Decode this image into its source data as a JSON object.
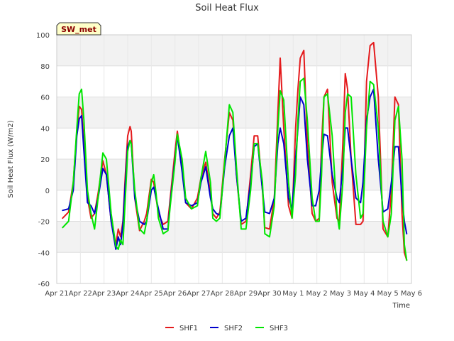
{
  "chart_data": {
    "type": "line",
    "title": "Soil Heat Flux",
    "xlabel": "Time",
    "ylabel": "Soil Heat Flux (W/m2)",
    "badge": "SW_met",
    "ylim": [
      -60,
      100
    ],
    "yticks": [
      -60,
      -40,
      -20,
      0,
      20,
      40,
      60,
      80,
      100
    ],
    "xlim": [
      0,
      15
    ],
    "xticks": [
      0,
      1,
      2,
      3,
      4,
      5,
      6,
      7,
      8,
      9,
      10,
      11,
      12,
      13,
      14,
      15
    ],
    "xtick_labels": [
      "Apr 21",
      "Apr 22",
      "Apr 23",
      "Apr 24",
      "Apr 25",
      "Apr 26",
      "Apr 27",
      "Apr 28",
      "Apr 29",
      "Apr 30",
      "May 1",
      "May 2",
      "May 3",
      "May 4",
      "May 5",
      "May 6"
    ],
    "grid": true,
    "legend_position": "bottom-center",
    "series": [
      {
        "name": "SHF1",
        "color": "#e41a1c",
        "x": [
          0.25,
          0.5,
          0.7,
          0.85,
          0.95,
          1.05,
          1.15,
          1.3,
          1.45,
          1.6,
          1.75,
          1.95,
          2.1,
          2.3,
          2.5,
          2.6,
          2.7,
          2.8,
          2.9,
          3.0,
          3.1,
          3.15,
          3.3,
          3.5,
          3.7,
          3.8,
          4.0,
          4.1,
          4.2,
          4.3,
          4.5,
          4.7,
          4.8,
          5.0,
          5.1,
          5.3,
          5.45,
          5.7,
          5.95,
          6.1,
          6.3,
          6.5,
          6.6,
          6.75,
          6.9,
          7.1,
          7.3,
          7.45,
          7.6,
          7.8,
          8.0,
          8.2,
          8.35,
          8.5,
          8.7,
          8.8,
          9.0,
          9.2,
          9.35,
          9.45,
          9.6,
          9.8,
          9.95,
          10.1,
          10.2,
          10.3,
          10.45,
          10.6,
          10.8,
          10.95,
          11.1,
          11.2,
          11.3,
          11.45,
          11.65,
          11.85,
          11.95,
          12.1,
          12.2,
          12.3,
          12.45,
          12.65,
          12.85,
          12.95,
          13.1,
          13.25,
          13.4,
          13.6,
          13.8,
          14.0,
          14.15,
          14.3,
          14.45,
          14.6,
          14.7,
          14.8
        ],
        "y": [
          -18,
          -14,
          5,
          38,
          54,
          52,
          30,
          -5,
          -18,
          -15,
          -2,
          19,
          10,
          -20,
          -35,
          -25,
          -30,
          -20,
          10,
          35,
          41,
          38,
          -5,
          -26,
          -20,
          -15,
          7,
          5,
          -5,
          -15,
          -22,
          -20,
          -5,
          25,
          38,
          15,
          -8,
          -12,
          -5,
          8,
          18,
          -2,
          -15,
          -18,
          -14,
          20,
          50,
          45,
          10,
          -22,
          -20,
          10,
          35,
          35,
          0,
          -24,
          -25,
          -5,
          50,
          85,
          40,
          -10,
          -18,
          40,
          65,
          85,
          90,
          30,
          -15,
          -20,
          -18,
          30,
          60,
          65,
          5,
          -18,
          -20,
          30,
          75,
          65,
          20,
          -22,
          -22,
          -20,
          70,
          93,
          95,
          60,
          -25,
          -30,
          0,
          60,
          55,
          -15,
          -40,
          -45
        ]
      },
      {
        "name": "SHF2",
        "color": "#0000cd",
        "x": [
          0.25,
          0.5,
          0.7,
          0.85,
          0.95,
          1.05,
          1.15,
          1.3,
          1.45,
          1.6,
          1.75,
          1.95,
          2.1,
          2.3,
          2.5,
          2.6,
          2.7,
          2.8,
          2.9,
          3.0,
          3.1,
          3.15,
          3.3,
          3.5,
          3.7,
          3.8,
          4.0,
          4.1,
          4.2,
          4.3,
          4.5,
          4.7,
          4.8,
          5.0,
          5.1,
          5.3,
          5.45,
          5.7,
          5.95,
          6.1,
          6.3,
          6.5,
          6.6,
          6.75,
          6.9,
          7.1,
          7.3,
          7.45,
          7.6,
          7.8,
          8.0,
          8.2,
          8.35,
          8.5,
          8.7,
          8.8,
          9.0,
          9.2,
          9.35,
          9.45,
          9.6,
          9.8,
          9.95,
          10.1,
          10.2,
          10.3,
          10.45,
          10.6,
          10.8,
          10.95,
          11.1,
          11.2,
          11.3,
          11.45,
          11.65,
          11.85,
          11.95,
          12.1,
          12.2,
          12.3,
          12.45,
          12.65,
          12.85,
          12.95,
          13.1,
          13.25,
          13.4,
          13.6,
          13.8,
          14.0,
          14.15,
          14.3,
          14.45,
          14.6,
          14.7,
          14.8
        ],
        "y": [
          -13,
          -12,
          0,
          35,
          46,
          48,
          25,
          -8,
          -10,
          -15,
          -5,
          14,
          10,
          -20,
          -38,
          -30,
          -35,
          -22,
          5,
          28,
          32,
          30,
          -5,
          -20,
          -22,
          -20,
          0,
          2,
          -5,
          -12,
          -25,
          -25,
          -8,
          20,
          35,
          12,
          -8,
          -10,
          -8,
          5,
          15,
          -5,
          -12,
          -15,
          -16,
          15,
          35,
          40,
          10,
          -20,
          -18,
          5,
          28,
          30,
          0,
          -14,
          -15,
          -5,
          30,
          40,
          30,
          -5,
          -12,
          20,
          40,
          60,
          55,
          20,
          -10,
          -10,
          0,
          20,
          36,
          35,
          10,
          -5,
          -8,
          15,
          40,
          40,
          20,
          -5,
          -8,
          5,
          45,
          60,
          65,
          20,
          -14,
          -12,
          5,
          28,
          28,
          -5,
          -20,
          -28
        ]
      },
      {
        "name": "SHF3",
        "color": "#00e600",
        "x": [
          0.25,
          0.5,
          0.7,
          0.85,
          0.95,
          1.05,
          1.15,
          1.3,
          1.45,
          1.6,
          1.75,
          1.95,
          2.1,
          2.3,
          2.5,
          2.6,
          2.7,
          2.8,
          2.9,
          3.0,
          3.1,
          3.15,
          3.3,
          3.5,
          3.7,
          3.8,
          4.0,
          4.1,
          4.2,
          4.3,
          4.5,
          4.7,
          4.8,
          5.0,
          5.1,
          5.3,
          5.45,
          5.7,
          5.95,
          6.1,
          6.3,
          6.5,
          6.6,
          6.75,
          6.9,
          7.1,
          7.3,
          7.45,
          7.6,
          7.8,
          8.0,
          8.2,
          8.35,
          8.5,
          8.7,
          8.8,
          9.0,
          9.2,
          9.35,
          9.45,
          9.6,
          9.8,
          9.95,
          10.1,
          10.2,
          10.3,
          10.45,
          10.6,
          10.8,
          10.95,
          11.1,
          11.2,
          11.3,
          11.45,
          11.65,
          11.85,
          11.95,
          12.1,
          12.2,
          12.3,
          12.45,
          12.65,
          12.85,
          12.95,
          13.1,
          13.25,
          13.4,
          13.6,
          13.8,
          14.0,
          14.15,
          14.3,
          14.45,
          14.6,
          14.7,
          14.8
        ],
        "y": [
          -24,
          -20,
          5,
          40,
          62,
          65,
          45,
          0,
          -15,
          -25,
          -5,
          24,
          20,
          -15,
          -36,
          -38,
          -32,
          -35,
          -5,
          25,
          32,
          30,
          0,
          -25,
          -28,
          -20,
          5,
          10,
          -2,
          -18,
          -28,
          -26,
          -10,
          18,
          36,
          20,
          -5,
          -12,
          -10,
          8,
          25,
          5,
          -18,
          -20,
          -18,
          18,
          55,
          50,
          15,
          -25,
          -25,
          0,
          30,
          30,
          5,
          -28,
          -30,
          -10,
          40,
          64,
          58,
          5,
          -18,
          10,
          45,
          70,
          72,
          45,
          -5,
          -20,
          -20,
          10,
          60,
          62,
          35,
          -15,
          -25,
          5,
          50,
          62,
          60,
          10,
          -18,
          -15,
          40,
          70,
          68,
          40,
          -20,
          -30,
          -15,
          45,
          54,
          20,
          -35,
          -45
        ]
      }
    ]
  }
}
